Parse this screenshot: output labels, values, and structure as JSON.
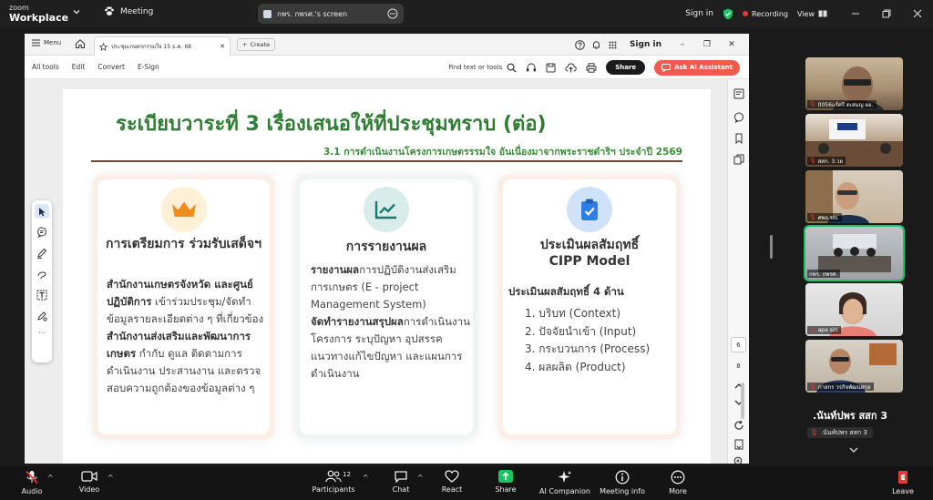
{
  "zoom": {
    "brand_line1": "zoom",
    "brand_line2": "Workplace",
    "meeting_label": "Meeting",
    "share_title": "กพร. กพรศ.'s screen",
    "signin": "Sign in",
    "recording": "Recording",
    "view": "View"
  },
  "document": {
    "menu_label": "Menu",
    "tab_title": "ประชุมเกษตรกรรมใจ 15 ธ.ค. 68",
    "create_label": "Create",
    "signin": "Sign in",
    "tools": [
      "All tools",
      "Edit",
      "Convert",
      "E-Sign"
    ],
    "find_label": "Find text or tools",
    "share_label": "Share",
    "ai_label": "Ask AI Assistant",
    "page_current": "6",
    "page_total": "8"
  },
  "slide": {
    "title": "ระเบียบวาระที่ 3 เรื่องเสนอให้ที่ประชุมทราบ (ต่อ)",
    "subtitle": "3.1 การดำเนินงานโครงการเกษตรรรมใจ อันเนื่องมาจากพระราชดำริฯ ประจำปี 2569",
    "card1": {
      "heading": "การเตรียมการ ร่วมรับเสด็จฯ",
      "p1_bold": "สำนักงานเกษตรจังหวัด และศูนย์ปฏิบัติการ",
      "p1_rest": " เข้าร่วมประชุม/จัดทำข้อมูลรายละเอียดต่าง ๆ ที่เกี่ยวข้อง",
      "p2_bold": "สำนักงานส่งเสริมและพัฒนาการเกษตร",
      "p2_rest": " กำกับ ดูแล ติดตามการดำเนินงาน ประสานงาน และตรวจสอบความถูกต้องของข้อมูลต่าง ๆ"
    },
    "card2": {
      "heading": "การรายงานผล",
      "p1_bold": "รายงานผล",
      "p1_rest": "การปฏิบัติงานส่งเสริมการเกษตร (E - project Management System)",
      "p2_bold": "จัดทำรายงานสรุปผล",
      "p2_rest": "การดำเนินงานโครงการ ระบุปัญหา อุปสรรค แนวทางแก้ไขปัญหา และแผนการดำเนินงาน"
    },
    "card3": {
      "heading1": "ประเมินผลสัมฤทธิ์",
      "heading2": "CIPP Model",
      "lead": "ประเมินผลสัมฤทธิ์ 4 ด้าน",
      "items": [
        "1. บริบท (Context)",
        "2. ปัจจัยนำเข้า (Input)",
        "3. กระบวนการ (Process)",
        "4. ผลผลิต (Product)"
      ]
    }
  },
  "participants": {
    "tiles": [
      "0056แร์ศรี ดเสมญ ผอ.",
      "สสก. 3.วย",
      "ศพอ.ขบ.",
      "กพร. กพรศ.",
      "apa siri",
      "ภาสกร วรกิจพัฒนสกุล"
    ],
    "active_speaker": ".นันท์ปพร สสก 3",
    "active_tag": ".นันท์ปพร สสก 3"
  },
  "controls": {
    "audio": "Audio",
    "video": "Video",
    "participants": "Participants",
    "participant_count": "12",
    "chat": "Chat",
    "react": "React",
    "share": "Share",
    "ai_companion": "AI Companion",
    "meeting_info": "Meeting info",
    "more": "More",
    "leave": "Leave"
  },
  "colors": {
    "title_green": "#2e7d32",
    "accent_coral": "#f05a4f",
    "zoom_green": "#19c463",
    "rule_brown": "#6b4a3a"
  }
}
